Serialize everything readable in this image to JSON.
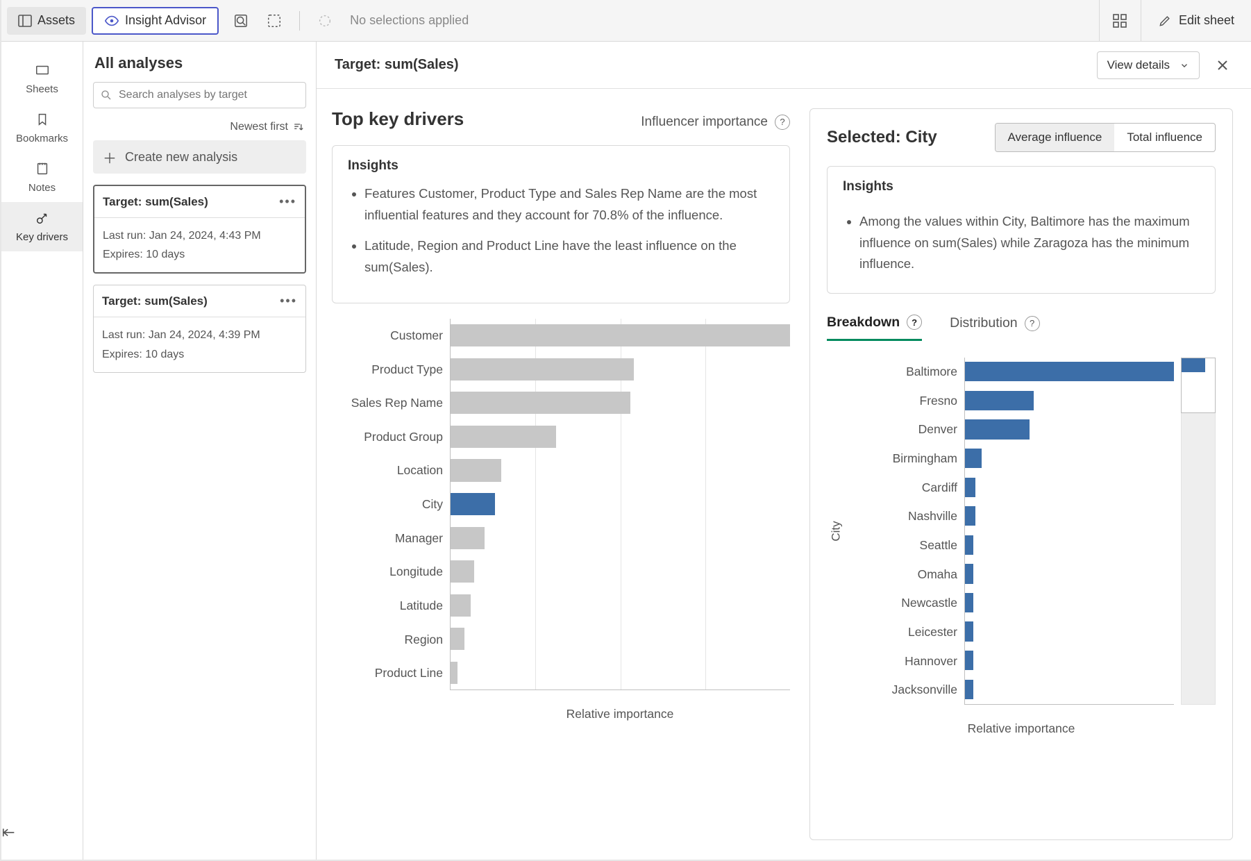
{
  "topbar": {
    "assets": "Assets",
    "insight": "Insight Advisor",
    "no_selections": "No selections applied",
    "edit": "Edit sheet"
  },
  "leftnav": {
    "sheets": "Sheets",
    "bookmarks": "Bookmarks",
    "notes": "Notes",
    "keydrivers": "Key drivers"
  },
  "analyses": {
    "title": "All analyses",
    "search_placeholder": "Search analyses by target",
    "sort": "Newest first",
    "create": "Create new analysis",
    "cards": [
      {
        "title": "Target: sum(Sales)",
        "lastrun": "Last run: Jan 24, 2024, 4:43 PM",
        "expires": "Expires: 10 days"
      },
      {
        "title": "Target: sum(Sales)",
        "lastrun": "Last run: Jan 24, 2024, 4:39 PM",
        "expires": "Expires: 10 days"
      }
    ]
  },
  "header": {
    "target": "Target: sum(Sales)",
    "details": "View details"
  },
  "keydrivers": {
    "title": "Top key drivers",
    "influencer_label": "Influencer importance",
    "insights_title": "Insights",
    "insights": [
      "Features Customer, Product Type and Sales Rep Name are the most influential features and they account for 70.8% of the influence.",
      "Latitude, Region and Product Line have the least influence on the sum(Sales)."
    ],
    "xlabel": "Relative importance"
  },
  "selected": {
    "prefix": "Selected: ",
    "value": "City",
    "avg": "Average influence",
    "total": "Total influence",
    "insights_title": "Insights",
    "insight": "Among the values within City, Baltimore has the maximum influence on sum(Sales) while Zaragoza has the minimum influence.",
    "tabs": {
      "breakdown": "Breakdown",
      "distribution": "Distribution"
    },
    "ylabel": "City",
    "xlabel": "Relative importance"
  },
  "chart_data": [
    {
      "type": "bar",
      "orientation": "horizontal",
      "title": "Top key drivers",
      "xlabel": "Relative importance",
      "categories": [
        "Customer",
        "Product Type",
        "Sales Rep Name",
        "Product Group",
        "Location",
        "City",
        "Manager",
        "Longitude",
        "Latitude",
        "Region",
        "Product Line"
      ],
      "values": [
        100,
        54,
        53,
        31,
        15,
        13,
        10,
        7,
        6,
        4,
        2
      ],
      "selected_category": "City"
    },
    {
      "type": "bar",
      "orientation": "horizontal",
      "title": "City breakdown",
      "xlabel": "Relative importance",
      "ylabel": "City",
      "categories": [
        "Baltimore",
        "Fresno",
        "Denver",
        "Birmingham",
        "Cardiff",
        "Nashville",
        "Seattle",
        "Omaha",
        "Newcastle",
        "Leicester",
        "Hannover",
        "Jacksonville"
      ],
      "values": [
        100,
        33,
        31,
        8,
        5,
        5,
        4,
        4,
        4,
        4,
        4,
        4
      ]
    }
  ]
}
